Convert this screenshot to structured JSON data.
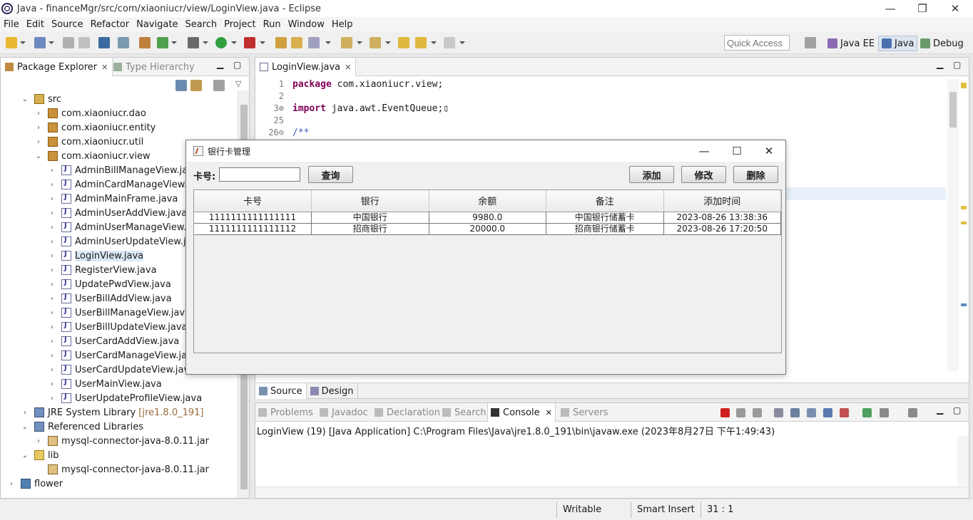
{
  "window": {
    "title": "Java - financeMgr/src/com/xiaoniucr/view/LoginView.java - Eclipse",
    "minimize": "—",
    "maximize": "❐",
    "close": "✕"
  },
  "menu": [
    "File",
    "Edit",
    "Source",
    "Refactor",
    "Navigate",
    "Search",
    "Project",
    "Run",
    "Window",
    "Help"
  ],
  "toolbar": {
    "quick_access_placeholder": "Quick Access",
    "perspectives": [
      "Java EE",
      "Java",
      "Debug"
    ]
  },
  "package_explorer": {
    "tabs": [
      "Package Explorer",
      "Type Hierarchy"
    ],
    "tree": [
      {
        "label": "src",
        "toggle": "⌄",
        "icon": "src"
      },
      {
        "label": "com.xiaoniucr.dao",
        "toggle": "›",
        "icon": "pkg"
      },
      {
        "label": "com.xiaoniucr.entity",
        "toggle": "›",
        "icon": "pkg"
      },
      {
        "label": "com.xiaoniucr.util",
        "toggle": "›",
        "icon": "pkg"
      },
      {
        "label": "com.xiaoniucr.view",
        "toggle": "⌄",
        "icon": "pkg"
      },
      {
        "label": "AdminBillManageView.java",
        "toggle": "›",
        "icon": "jfile"
      },
      {
        "label": "AdminCardManageView.java",
        "toggle": "›",
        "icon": "jfile"
      },
      {
        "label": "AdminMainFrame.java",
        "toggle": "›",
        "icon": "jfile"
      },
      {
        "label": "AdminUserAddView.java",
        "toggle": "›",
        "icon": "jfile"
      },
      {
        "label": "AdminUserManageView.java",
        "toggle": "›",
        "icon": "jfile"
      },
      {
        "label": "AdminUserUpdateView.java",
        "toggle": "›",
        "icon": "jfile"
      },
      {
        "label": "LoginView.java",
        "toggle": "›",
        "icon": "jfile",
        "selected": true
      },
      {
        "label": "RegisterView.java",
        "toggle": "›",
        "icon": "jfile"
      },
      {
        "label": "UpdatePwdView.java",
        "toggle": "›",
        "icon": "jfile"
      },
      {
        "label": "UserBillAddView.java",
        "toggle": "›",
        "icon": "jfile"
      },
      {
        "label": "UserBillManageView.java",
        "toggle": "›",
        "icon": "jfile"
      },
      {
        "label": "UserBillUpdateView.java",
        "toggle": "›",
        "icon": "jfile"
      },
      {
        "label": "UserCardAddView.java",
        "toggle": "›",
        "icon": "jfile"
      },
      {
        "label": "UserCardManageView.java",
        "toggle": "›",
        "icon": "jfile"
      },
      {
        "label": "UserCardUpdateView.java",
        "toggle": "›",
        "icon": "jfile"
      },
      {
        "label": "UserMainView.java",
        "toggle": "›",
        "icon": "jfile"
      },
      {
        "label": "UserUpdateProfileView.java",
        "toggle": "›",
        "icon": "jfile"
      },
      {
        "label": "JRE System Library",
        "decoration": "[jre1.8.0_191]",
        "toggle": "›",
        "icon": "lib"
      },
      {
        "label": "Referenced Libraries",
        "toggle": "⌄",
        "icon": "lib"
      },
      {
        "label": "mysql-connector-java-8.0.11.jar",
        "toggle": "›",
        "icon": "jar"
      },
      {
        "label": "lib",
        "toggle": "⌄",
        "icon": "folder"
      },
      {
        "label": "mysql-connector-java-8.0.11.jar",
        "toggle": "",
        "icon": "jar"
      },
      {
        "label": "flower",
        "toggle": "›",
        "icon": "proj"
      }
    ]
  },
  "editor": {
    "tab": "LoginView.java",
    "lines": [
      {
        "num": "1",
        "kw": "package",
        "rest": " com.xiaoniucr.view;"
      },
      {
        "num": "2",
        "kw": "",
        "rest": ""
      },
      {
        "num": "3⊕",
        "kw": "import",
        "rest": " java.awt.EventQueue;▯"
      },
      {
        "num": "25",
        "kw": "",
        "rest": ""
      },
      {
        "num": "26⊖",
        "kw": "",
        "rest": "/**"
      }
    ],
    "bottom_tabs": [
      "Source",
      "Design"
    ]
  },
  "dialog": {
    "title": "银行卡管理",
    "card_label": "卡号:",
    "card_input_value": "",
    "search_button": "查询",
    "add_button": "添加",
    "edit_button": "修改",
    "delete_button": "删除",
    "columns": [
      "卡号",
      "银行",
      "余额",
      "备注",
      "添加时间"
    ],
    "rows": [
      [
        "1111111111111111",
        "中国银行",
        "9980.0",
        "中国银行储蓄卡",
        "2023-08-26 13:38:36"
      ],
      [
        "1111111111111112",
        "招商银行",
        "20000.0",
        "招商银行储蓄卡",
        "2023-08-26 17:20:50"
      ]
    ]
  },
  "console": {
    "tabs": [
      "Problems",
      "Javadoc",
      "Declaration",
      "Search",
      "Console",
      "Servers"
    ],
    "output": "LoginView (19) [Java Application] C:\\Program Files\\Java\\jre1.8.0_191\\bin\\javaw.exe (2023年8月27日 下午1:49:43)"
  },
  "status": {
    "writable": "Writable",
    "insert_mode": "Smart Insert",
    "position": "31 : 1"
  }
}
